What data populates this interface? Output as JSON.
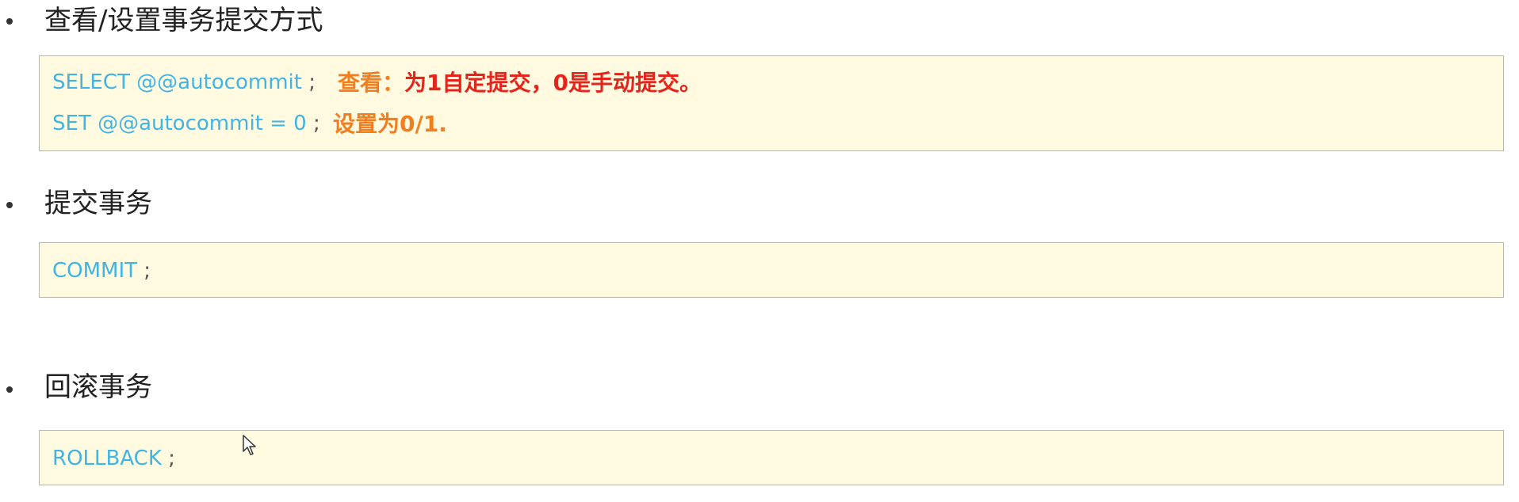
{
  "sections": [
    {
      "heading": "查看/设置事务提交方式",
      "code": [
        {
          "text": "SELECT  @@autocommit",
          "semi": " ;",
          "note": {
            "label": "查看：",
            "text": "为1自定提交，0是手动提交。"
          }
        },
        {
          "text": "SET   @@autocommit = 0",
          "semi": " ;",
          "note": {
            "label": "设置为0/1."
          }
        }
      ]
    },
    {
      "heading": "提交事务",
      "code": [
        {
          "text": "COMMIT",
          "semi": " ;"
        }
      ]
    },
    {
      "heading": "回滚事务",
      "code": [
        {
          "text": "ROLLBACK",
          "semi": " ;"
        }
      ]
    }
  ],
  "colors": {
    "code_keyword": "#3fb4e6",
    "note_label": "#f17f1f",
    "note_text": "#e5241b",
    "code_background": "#fffae0"
  },
  "icons": {
    "cursor": "mouse-pointer-icon"
  }
}
